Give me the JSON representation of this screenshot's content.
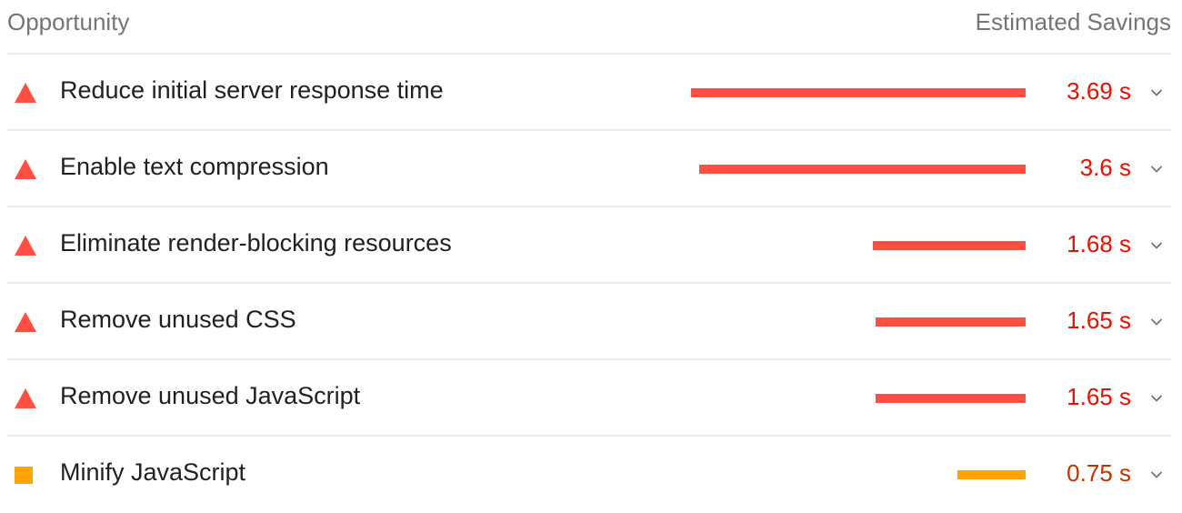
{
  "header": {
    "opportunity_label": "Opportunity",
    "savings_label": "Estimated Savings"
  },
  "colors": {
    "fail": "#ff4e42",
    "fail_text": "#eb0f00",
    "average": "#ffa400",
    "average_text": "#c33300",
    "divider": "#ebebeb",
    "muted_text": "#757575"
  },
  "opportunities": [
    {
      "title": "Reduce initial server response time",
      "savings": "3.69 s",
      "savings_seconds": 3.69,
      "rating": "fail",
      "icon": "triangle-fail-icon"
    },
    {
      "title": "Enable text compression",
      "savings": "3.6 s",
      "savings_seconds": 3.6,
      "rating": "fail",
      "icon": "triangle-fail-icon"
    },
    {
      "title": "Eliminate render-blocking resources",
      "savings": "1.68 s",
      "savings_seconds": 1.68,
      "rating": "fail",
      "icon": "triangle-fail-icon"
    },
    {
      "title": "Remove unused CSS",
      "savings": "1.65 s",
      "savings_seconds": 1.65,
      "rating": "fail",
      "icon": "triangle-fail-icon"
    },
    {
      "title": "Remove unused JavaScript",
      "savings": "1.65 s",
      "savings_seconds": 1.65,
      "rating": "fail",
      "icon": "triangle-fail-icon"
    },
    {
      "title": "Minify JavaScript",
      "savings": "0.75 s",
      "savings_seconds": 0.75,
      "rating": "average",
      "icon": "square-average-icon"
    }
  ]
}
